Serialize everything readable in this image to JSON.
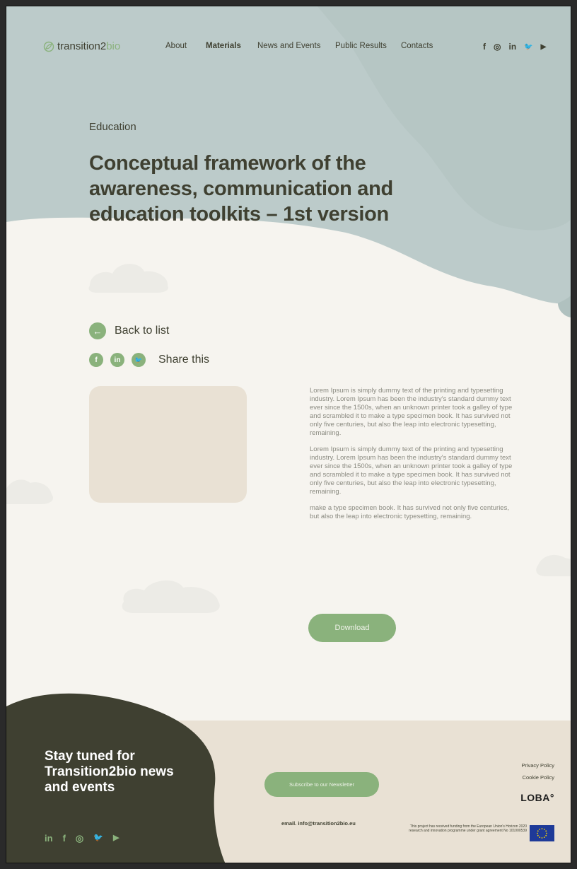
{
  "brand": {
    "part1": "transition2",
    "part2": "bio"
  },
  "nav": {
    "items": [
      {
        "label": "About",
        "active": false
      },
      {
        "label": "Materials",
        "active": true
      },
      {
        "label": "News and Events",
        "active": false
      },
      {
        "label": "Public Results",
        "active": false
      },
      {
        "label": "Contacts",
        "active": false
      }
    ],
    "social": [
      "f",
      "◎",
      "in",
      "🐦",
      "▶"
    ]
  },
  "hero": {
    "category": "Education",
    "title": "Conceptual framework of the awareness, communication and education toolkits – 1st version"
  },
  "actions": {
    "back_label": "Back to list",
    "back_icon": "←",
    "share_label": "Share this",
    "share_icons": [
      "f",
      "in",
      "🐦"
    ]
  },
  "article": {
    "paragraphs": [
      "Lorem Ipsum is simply dummy text of the printing and typesetting industry. Lorem Ipsum has been the industry's standard dummy text ever since the 1500s, when an unknown printer took a galley of type and scrambled it to make a type specimen book. It has survived not only five centuries, but also the leap into electronic typesetting, remaining.",
      "Lorem Ipsum is simply dummy text of the printing and typesetting industry. Lorem Ipsum has been the industry's standard dummy text ever since the 1500s, when an unknown printer took a galley of type and scrambled it to make a type specimen book. It has survived not only five centuries, but also the leap into electronic typesetting, remaining.",
      "make a type specimen book. It has survived not only five centuries, but also the leap into electronic typesetting, remaining."
    ],
    "download_label": "Download"
  },
  "footer": {
    "headline": "Stay tuned for Transition2bio news and events",
    "social": [
      "in",
      "f",
      "◎",
      "🐦",
      "▶"
    ],
    "subscribe_label": "Subscribe to our Newsletter",
    "email": "email. info@transition2bio.eu",
    "privacy": "Privacy Policy",
    "cookie": "Cookie Policy",
    "loba": "LOBA°",
    "funding": "This project has received funding from the European Union's Horizon 2020 research and innovation programme under grant agreement No 101000539"
  },
  "colors": {
    "accent": "#8ab27c",
    "hero_bg": "#bccbca",
    "dark": "#3f4031",
    "footer_bg": "#e9e1d4",
    "footer_blob": "#3f4031"
  }
}
